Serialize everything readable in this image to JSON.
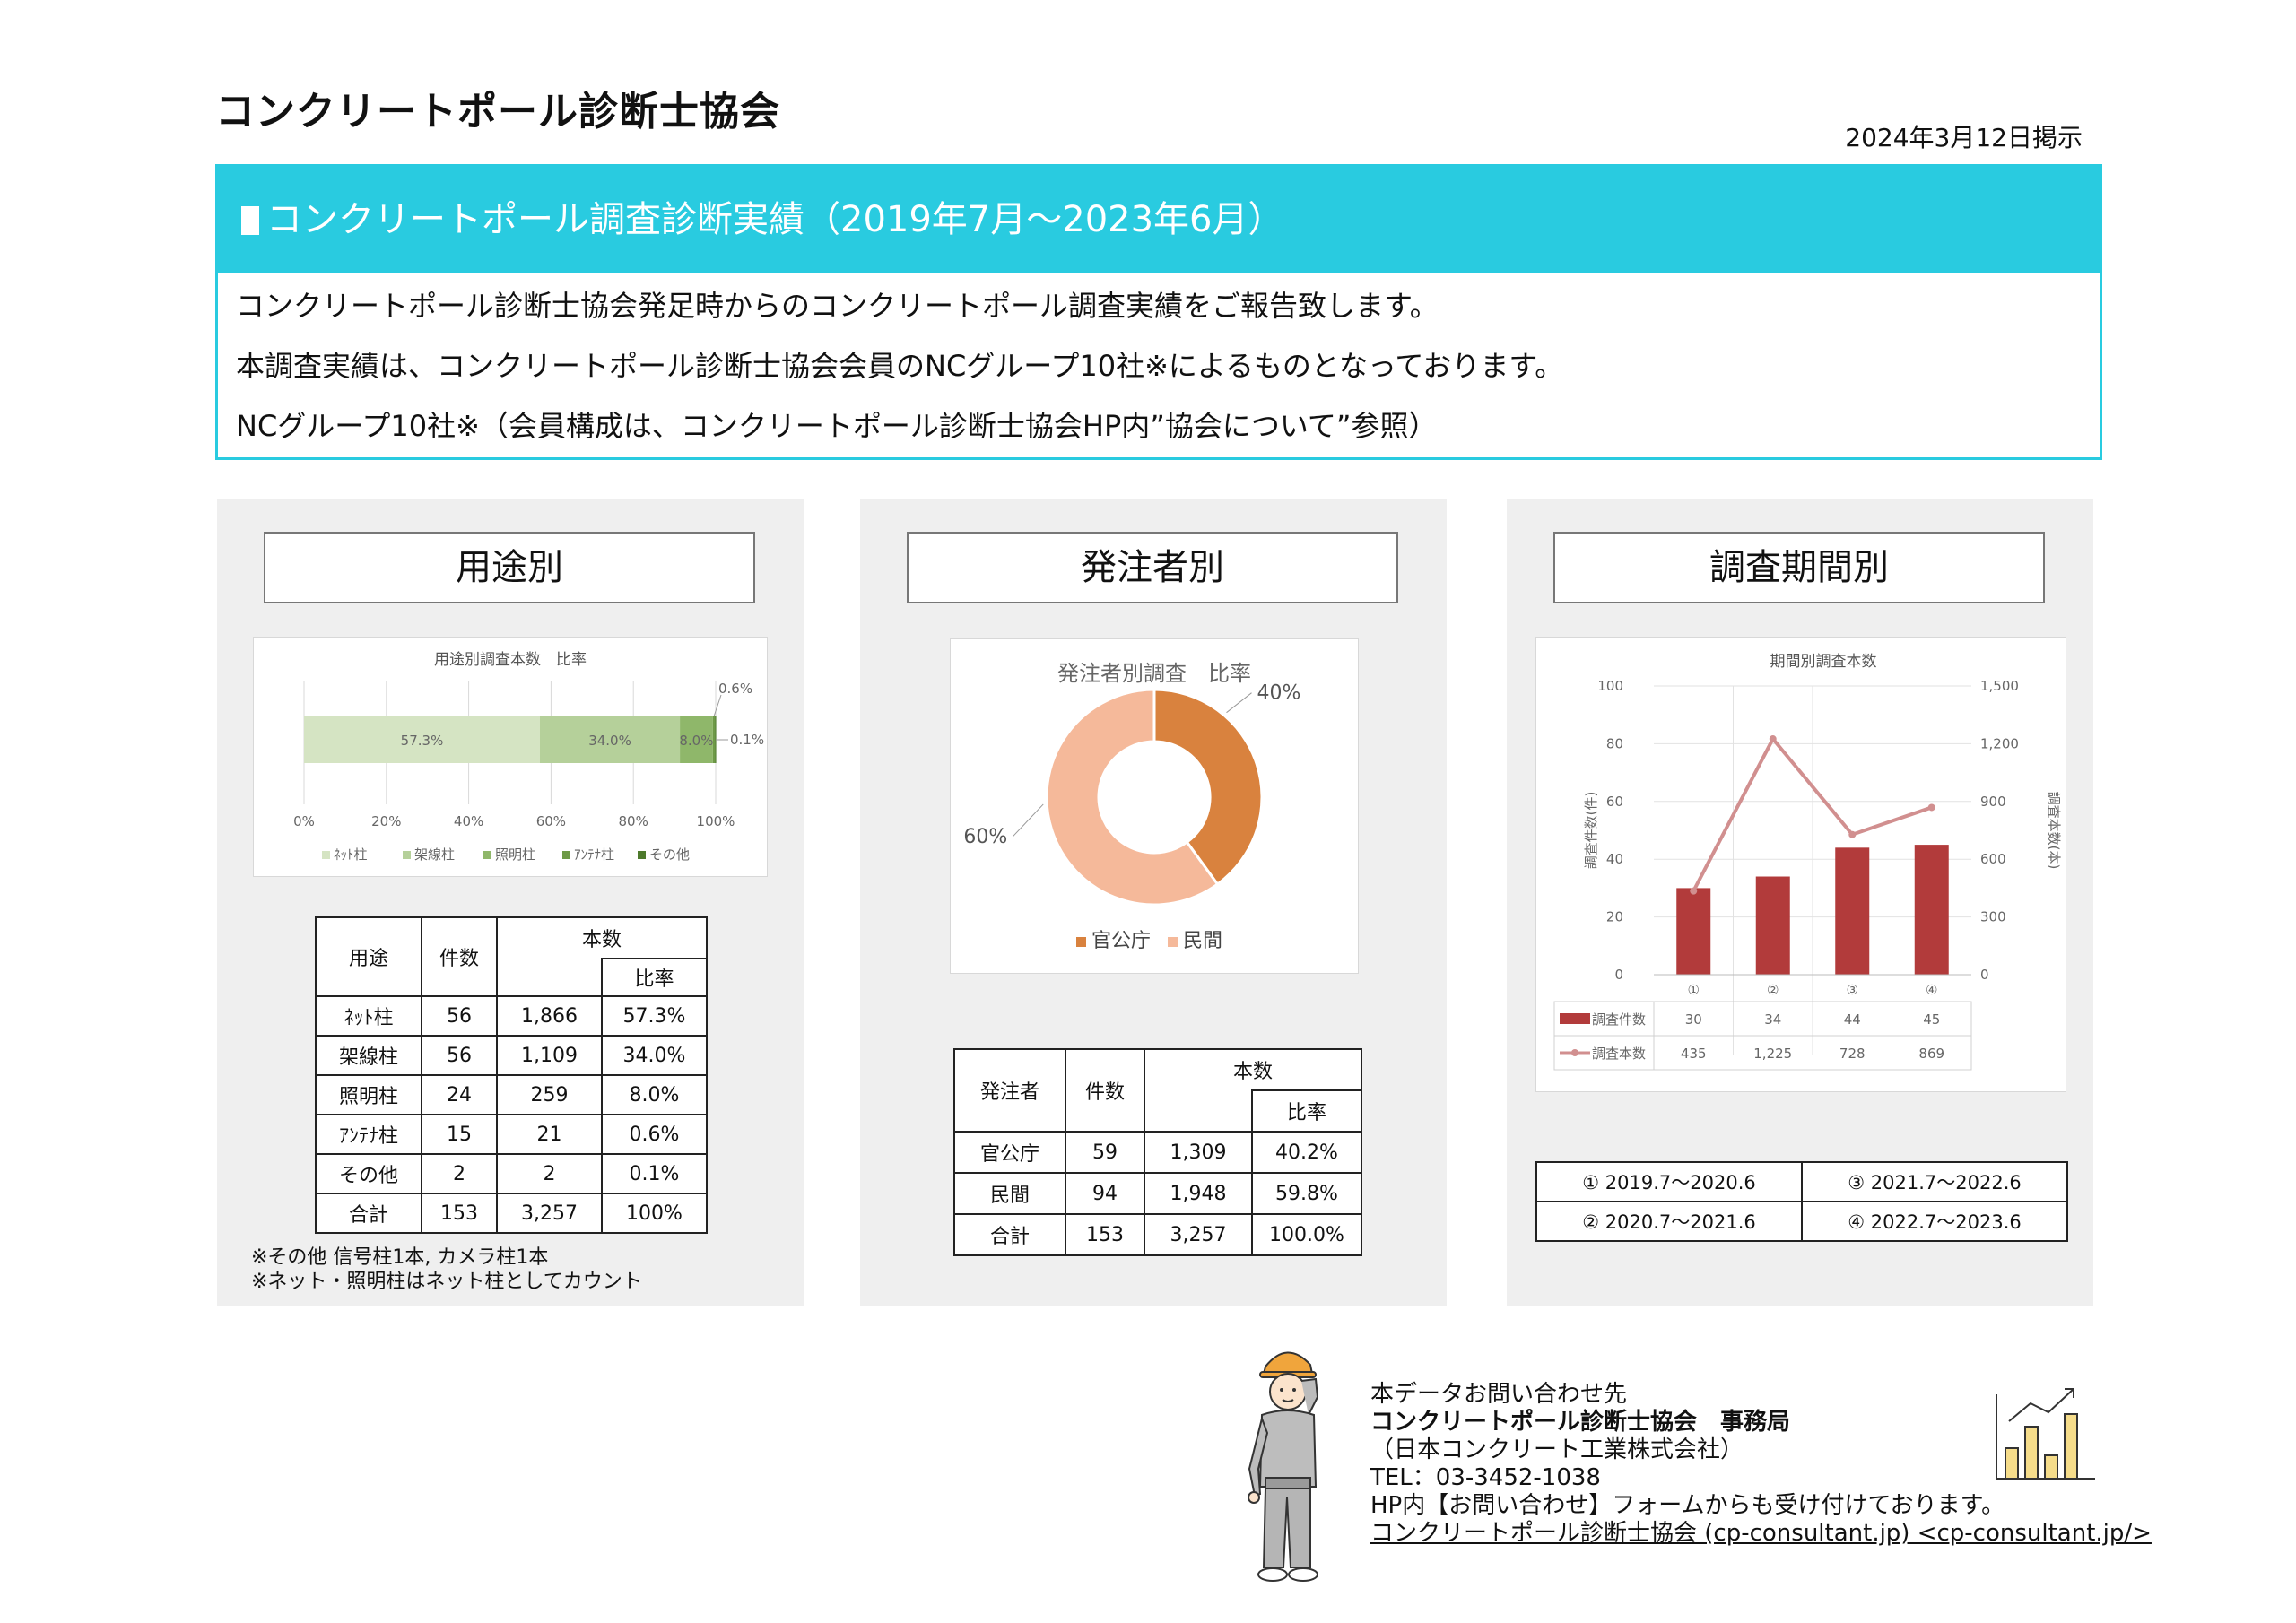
{
  "header": {
    "org_title": "コンクリートポール診断士協会",
    "posted_date": "2024年3月12日掲示"
  },
  "hero": {
    "title": "コンクリートポール調査診断実績（2019年7月～2023年6月）",
    "line1": "コンクリートポール診断士協会発足時からのコンクリートポール調査実績をご報告致します。",
    "line2": "本調査実績は、コンクリートポール診断士協会会員のNCグループ10社※によるものとなっております。",
    "line3": "NCグループ10社※（会員構成は、コンクリートポール診断士協会HP内”協会について”参照）"
  },
  "panel_use": {
    "title": "用途別",
    "table_headers": {
      "use": "用途",
      "count": "件数",
      "poles": "本数",
      "ratio": "比率"
    },
    "rows": [
      {
        "name": "ﾈｯﾄ柱",
        "count": "56",
        "poles": "1,866",
        "ratio": "57.3%"
      },
      {
        "name": "架線柱",
        "count": "56",
        "poles": "1,109",
        "ratio": "34.0%"
      },
      {
        "name": "照明柱",
        "count": "24",
        "poles": "259",
        "ratio": "8.0%"
      },
      {
        "name": "ｱﾝﾃﾅ柱",
        "count": "15",
        "poles": "21",
        "ratio": "0.6%"
      },
      {
        "name": "その他",
        "count": "2",
        "poles": "2",
        "ratio": "0.1%"
      },
      {
        "name": "合計",
        "count": "153",
        "poles": "3,257",
        "ratio": "100%"
      }
    ],
    "note1": "※その他 信号柱1本, カメラ柱1本",
    "note2": "※ネット・照明柱はネット柱としてカウント"
  },
  "panel_orderer": {
    "title": "発注者別",
    "table_headers": {
      "orderer": "発注者",
      "count": "件数",
      "poles": "本数",
      "ratio": "比率"
    },
    "rows": [
      {
        "name": "官公庁",
        "count": "59",
        "poles": "1,309",
        "ratio": "40.2%"
      },
      {
        "name": "民間",
        "count": "94",
        "poles": "1,948",
        "ratio": "59.8%"
      },
      {
        "name": "合計",
        "count": "153",
        "poles": "3,257",
        "ratio": "100.0%"
      }
    ]
  },
  "panel_period": {
    "title": "調査期間別",
    "periods": [
      {
        "label": "① 2019.7～2020.6"
      },
      {
        "label": "③ 2021.7～2022.6"
      },
      {
        "label": "② 2020.7～2021.6"
      },
      {
        "label": "④ 2022.7～2023.6"
      }
    ]
  },
  "contact": {
    "line1": "本データお問い合わせ先",
    "line2": "コンクリートポール診断士協会　事務局",
    "line3": "（日本コンクリート工業株式会社）",
    "line4": "TEL：03-3452-1038",
    "line5": "HP内【お問い合わせ】フォームからも受け付けております。",
    "line6": "コンクリートポール診断士協会 (cp-consultant.jp) <cp-consultant.jp/>"
  },
  "chart_data": [
    {
      "type": "bar",
      "stacked": true,
      "orientation": "horizontal",
      "title": "用途別調査本数　比率",
      "categories": [
        ""
      ],
      "series": [
        {
          "name": "ﾈｯﾄ柱",
          "values": [
            57.3
          ],
          "label": "57.3%",
          "color": "#d5e4c3"
        },
        {
          "name": "架線柱",
          "values": [
            34.0
          ],
          "label": "34.0%",
          "color": "#b5d09a"
        },
        {
          "name": "照明柱",
          "values": [
            8.0
          ],
          "label": "8.0%",
          "color": "#8fb76a"
        },
        {
          "name": "ｱﾝﾃﾅ柱",
          "values": [
            0.6
          ],
          "label": "0.6%",
          "color": "#6e9a47"
        },
        {
          "name": "その他",
          "values": [
            0.1
          ],
          "label": "0.1%",
          "color": "#4e7a2c"
        }
      ],
      "x_ticks": [
        "0%",
        "20%",
        "40%",
        "60%",
        "80%",
        "100%"
      ],
      "xlim": [
        0,
        100
      ],
      "legend": "bottom",
      "grid": true
    },
    {
      "type": "pie",
      "donut": true,
      "title": "発注者別調査　比率",
      "slices": [
        {
          "name": "官公庁",
          "value": 40,
          "label": "40%",
          "color": "#d9823e"
        },
        {
          "name": "民間",
          "value": 60,
          "label": "60%",
          "color": "#f5b99a"
        }
      ],
      "legend": "bottom"
    },
    {
      "type": "bar",
      "combo_line": true,
      "title": "期間別調査本数",
      "categories": [
        "①",
        "②",
        "③",
        "④"
      ],
      "series": [
        {
          "name": "調査件数",
          "type": "bar",
          "axis": "left",
          "values": [
            30,
            34,
            44,
            45
          ],
          "color": "#b23b3b"
        },
        {
          "name": "調査本数",
          "type": "line",
          "axis": "right",
          "values": [
            435,
            1225,
            728,
            869
          ],
          "color": "#d18f8f"
        }
      ],
      "ylabel": "調査件数(件)",
      "y2label": "調査本数(本)",
      "ylim": [
        0,
        100
      ],
      "y2lim": [
        0,
        1500
      ],
      "y_ticks": [
        "0",
        "20",
        "40",
        "60",
        "80",
        "100"
      ],
      "y2_ticks": [
        "0",
        "300",
        "600",
        "900",
        "1,200",
        "1,500"
      ],
      "data_table": true,
      "grid": true
    }
  ]
}
